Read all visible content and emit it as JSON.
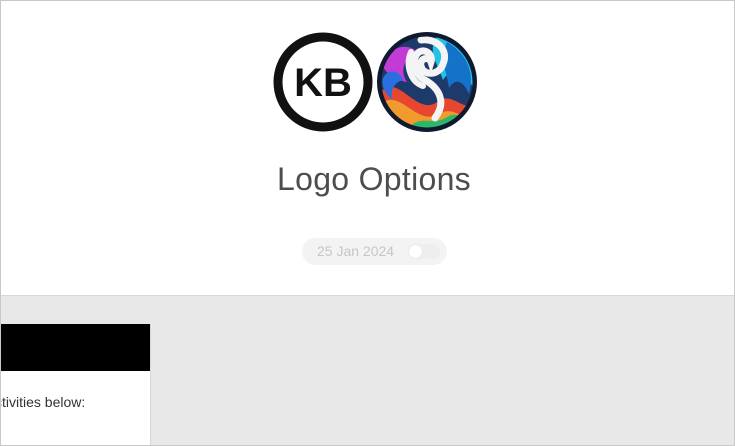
{
  "header": {
    "logos": [
      {
        "name": "kb-logo",
        "text": "KB"
      },
      {
        "name": "swirl-logo"
      }
    ],
    "title": "Logo Options",
    "date": "25 Jan 2024",
    "toggle_on": false
  },
  "content": {
    "card": {
      "text": "ctivities below:"
    }
  },
  "colors": {
    "page_bg": "#ffffff",
    "content_bg": "#e8e8e8",
    "title": "#4d4d4d",
    "card_header": "#000000"
  }
}
